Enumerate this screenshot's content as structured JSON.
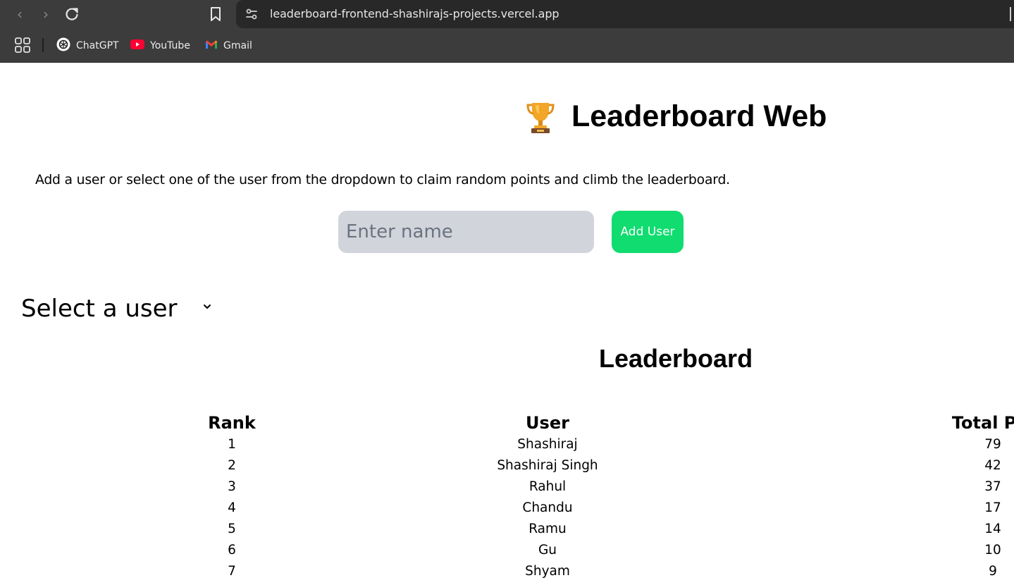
{
  "browser": {
    "url": "leaderboard-frontend-shashirajs-projects.vercel.app",
    "bookmarks": [
      {
        "label": "ChatGPT",
        "icon": "chatgpt-icon"
      },
      {
        "label": "YouTube",
        "icon": "youtube-icon"
      },
      {
        "label": "Gmail",
        "icon": "gmail-icon"
      }
    ]
  },
  "page": {
    "title": "Leaderboard Web",
    "title_icon": "trophy-icon",
    "intro": "Add a user or select one of the user from the dropdown to claim random points and climb the leaderboard.",
    "name_input": {
      "value": "",
      "placeholder": "Enter name"
    },
    "add_button": "Add User",
    "add_button_color": "#10dc70",
    "select": {
      "selected": "Select a user"
    },
    "leaderboard": {
      "title": "Leaderboard",
      "columns": [
        "Rank",
        "User",
        "Total Poi"
      ],
      "rows": [
        {
          "rank": "1",
          "user": "Shashiraj",
          "points": "79"
        },
        {
          "rank": "2",
          "user": "Shashiraj Singh",
          "points": "42"
        },
        {
          "rank": "3",
          "user": "Rahul",
          "points": "37"
        },
        {
          "rank": "4",
          "user": "Chandu",
          "points": "17"
        },
        {
          "rank": "5",
          "user": "Ramu",
          "points": "14"
        },
        {
          "rank": "6",
          "user": "Gu",
          "points": "10"
        },
        {
          "rank": "7",
          "user": "Shyam",
          "points": "9"
        }
      ]
    }
  }
}
